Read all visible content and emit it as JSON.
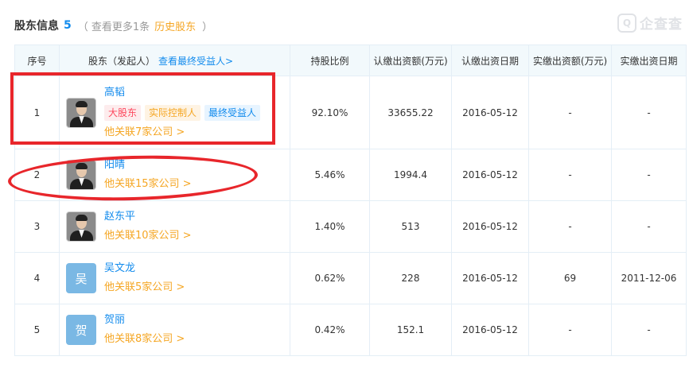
{
  "header": {
    "title": "股东信息",
    "count": "5",
    "more_prefix": "（ 查看更多1条",
    "history_link": "历史股东",
    "more_suffix": "）"
  },
  "logo": {
    "mark": "Q",
    "text": "企查查"
  },
  "table": {
    "columns": {
      "index": "序号",
      "holder": "股东（发起人）",
      "holder_link": "查看最终受益人>",
      "ratio": "持股比例",
      "subscribed": "认缴出资额(万元)",
      "subscribed_date": "认缴出资日期",
      "paid": "实缴出资额(万元)",
      "paid_date": "实缴出资日期"
    },
    "rows": [
      {
        "index": "1",
        "name": "高韬",
        "avatar_text": "",
        "tags": [
          "大股东",
          "实际控制人",
          "最终受益人"
        ],
        "related": "他关联7家公司 >",
        "ratio": "92.10%",
        "subscribed": "33655.22",
        "subscribed_date": "2016-05-12",
        "paid": "-",
        "paid_date": "-"
      },
      {
        "index": "2",
        "name": "阳晴",
        "avatar_text": "",
        "tags": [],
        "related": "他关联15家公司 >",
        "ratio": "5.46%",
        "subscribed": "1994.4",
        "subscribed_date": "2016-05-12",
        "paid": "-",
        "paid_date": "-"
      },
      {
        "index": "3",
        "name": "赵东平",
        "avatar_text": "",
        "tags": [],
        "related": "他关联10家公司 >",
        "ratio": "1.40%",
        "subscribed": "513",
        "subscribed_date": "2016-05-12",
        "paid": "-",
        "paid_date": "-"
      },
      {
        "index": "4",
        "name": "吴文龙",
        "avatar_text": "吴",
        "tags": [],
        "related": "他关联5家公司 >",
        "ratio": "0.62%",
        "subscribed": "228",
        "subscribed_date": "2016-05-12",
        "paid": "69",
        "paid_date": "2011-12-06"
      },
      {
        "index": "5",
        "name": "贺丽",
        "avatar_text": "贺",
        "tags": [],
        "related": "他关联8家公司 >",
        "ratio": "0.42%",
        "subscribed": "152.1",
        "subscribed_date": "2016-05-12",
        "paid": "-",
        "paid_date": "-"
      }
    ]
  },
  "colors": {
    "accent_blue": "#128bed",
    "accent_orange": "#f5a623",
    "tag_red": "#fd485e",
    "annotation_red": "#e8262b",
    "header_bg": "#f2f9fc",
    "border": "#e4eef6"
  }
}
